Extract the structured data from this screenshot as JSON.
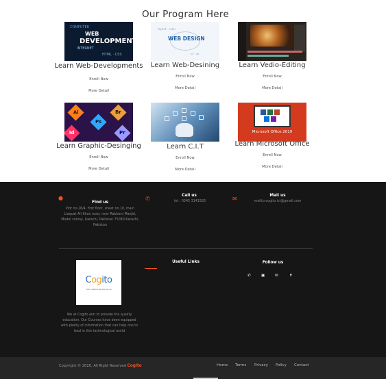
{
  "section": {
    "title": "Our Program Here"
  },
  "courses": [
    {
      "title": "Learn Web-Developments",
      "enroll": "Enroll Now",
      "details": "More Detail"
    },
    {
      "title": "Learn Web-Desining",
      "enroll": "Enroll Now",
      "details": "More Detail"
    },
    {
      "title": "Learn Vedio-Editing",
      "enroll": "Enroll Now",
      "details": "More Detail"
    },
    {
      "title": "Learn Graphic-Desinging",
      "enroll": "Enroll Now",
      "details": "More Detail"
    },
    {
      "title": "Learn C.I.T",
      "enroll": "Enroll Now",
      "details": "More Detail"
    },
    {
      "title": "Learn Microsoft Office",
      "enroll": "Enroll Now",
      "details": "More Detail"
    }
  ],
  "thumbs": {
    "web_line1": "COMPUTER",
    "web_line2": "WEB DEVELOPMENT",
    "web_line3": "INTERNET",
    "design_label": "WEB DESIGN",
    "office_caption": "Microsoft Office 2019",
    "ps": "Ps",
    "br": "Br",
    "ai": "Ai"
  },
  "footer": {
    "find_us": {
      "heading": "Find us",
      "address": "Plot no.26/4, first floor, sheet no.10, main Liaquat Ali Khan road, near Rabbani Masjid, Model colony, Karachi, Pakistan 75080 Karachi, Pakistan"
    },
    "call_us": {
      "heading": "Call us",
      "phone": "tel : 0345 3141583"
    },
    "mail_us": {
      "heading": "Mail us",
      "email": "mailto:cogito.ict@gmail.com"
    },
    "logo": {
      "text_a": "C",
      "text_b": "og",
      "text_c": "i",
      "text_d": "to",
      "tagline": "THE COMPUTER INSTITUTE"
    },
    "about": "We at Cogito aim to provide the quality education. Our Courses have been equipped with plenty of information that can help one to lead in this technological world",
    "useful_links": {
      "heading": "Useful Links"
    },
    "follow_us": {
      "heading": "Follow us"
    },
    "copyright_prefix": "Copyright © 2020, All Right Reserved",
    "brand": "Cogito",
    "nav": [
      "Home",
      "Terms",
      "Privacy",
      "Policy",
      "Contact"
    ]
  },
  "colors": {
    "accent": "#f4511e",
    "footer_bg": "#161616",
    "bottom_bg": "#262626"
  }
}
